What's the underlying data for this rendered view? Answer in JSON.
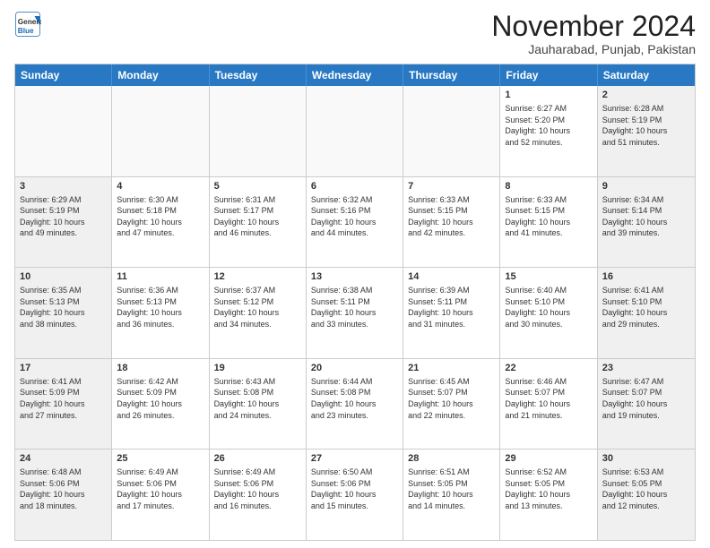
{
  "header": {
    "logo_line1": "General",
    "logo_line2": "Blue",
    "month": "November 2024",
    "location": "Jauharabad, Punjab, Pakistan"
  },
  "weekdays": [
    "Sunday",
    "Monday",
    "Tuesday",
    "Wednesday",
    "Thursday",
    "Friday",
    "Saturday"
  ],
  "rows": [
    [
      {
        "day": "",
        "info": ""
      },
      {
        "day": "",
        "info": ""
      },
      {
        "day": "",
        "info": ""
      },
      {
        "day": "",
        "info": ""
      },
      {
        "day": "",
        "info": ""
      },
      {
        "day": "1",
        "info": "Sunrise: 6:27 AM\nSunset: 5:20 PM\nDaylight: 10 hours\nand 52 minutes."
      },
      {
        "day": "2",
        "info": "Sunrise: 6:28 AM\nSunset: 5:19 PM\nDaylight: 10 hours\nand 51 minutes."
      }
    ],
    [
      {
        "day": "3",
        "info": "Sunrise: 6:29 AM\nSunset: 5:19 PM\nDaylight: 10 hours\nand 49 minutes."
      },
      {
        "day": "4",
        "info": "Sunrise: 6:30 AM\nSunset: 5:18 PM\nDaylight: 10 hours\nand 47 minutes."
      },
      {
        "day": "5",
        "info": "Sunrise: 6:31 AM\nSunset: 5:17 PM\nDaylight: 10 hours\nand 46 minutes."
      },
      {
        "day": "6",
        "info": "Sunrise: 6:32 AM\nSunset: 5:16 PM\nDaylight: 10 hours\nand 44 minutes."
      },
      {
        "day": "7",
        "info": "Sunrise: 6:33 AM\nSunset: 5:15 PM\nDaylight: 10 hours\nand 42 minutes."
      },
      {
        "day": "8",
        "info": "Sunrise: 6:33 AM\nSunset: 5:15 PM\nDaylight: 10 hours\nand 41 minutes."
      },
      {
        "day": "9",
        "info": "Sunrise: 6:34 AM\nSunset: 5:14 PM\nDaylight: 10 hours\nand 39 minutes."
      }
    ],
    [
      {
        "day": "10",
        "info": "Sunrise: 6:35 AM\nSunset: 5:13 PM\nDaylight: 10 hours\nand 38 minutes."
      },
      {
        "day": "11",
        "info": "Sunrise: 6:36 AM\nSunset: 5:13 PM\nDaylight: 10 hours\nand 36 minutes."
      },
      {
        "day": "12",
        "info": "Sunrise: 6:37 AM\nSunset: 5:12 PM\nDaylight: 10 hours\nand 34 minutes."
      },
      {
        "day": "13",
        "info": "Sunrise: 6:38 AM\nSunset: 5:11 PM\nDaylight: 10 hours\nand 33 minutes."
      },
      {
        "day": "14",
        "info": "Sunrise: 6:39 AM\nSunset: 5:11 PM\nDaylight: 10 hours\nand 31 minutes."
      },
      {
        "day": "15",
        "info": "Sunrise: 6:40 AM\nSunset: 5:10 PM\nDaylight: 10 hours\nand 30 minutes."
      },
      {
        "day": "16",
        "info": "Sunrise: 6:41 AM\nSunset: 5:10 PM\nDaylight: 10 hours\nand 29 minutes."
      }
    ],
    [
      {
        "day": "17",
        "info": "Sunrise: 6:41 AM\nSunset: 5:09 PM\nDaylight: 10 hours\nand 27 minutes."
      },
      {
        "day": "18",
        "info": "Sunrise: 6:42 AM\nSunset: 5:09 PM\nDaylight: 10 hours\nand 26 minutes."
      },
      {
        "day": "19",
        "info": "Sunrise: 6:43 AM\nSunset: 5:08 PM\nDaylight: 10 hours\nand 24 minutes."
      },
      {
        "day": "20",
        "info": "Sunrise: 6:44 AM\nSunset: 5:08 PM\nDaylight: 10 hours\nand 23 minutes."
      },
      {
        "day": "21",
        "info": "Sunrise: 6:45 AM\nSunset: 5:07 PM\nDaylight: 10 hours\nand 22 minutes."
      },
      {
        "day": "22",
        "info": "Sunrise: 6:46 AM\nSunset: 5:07 PM\nDaylight: 10 hours\nand 21 minutes."
      },
      {
        "day": "23",
        "info": "Sunrise: 6:47 AM\nSunset: 5:07 PM\nDaylight: 10 hours\nand 19 minutes."
      }
    ],
    [
      {
        "day": "24",
        "info": "Sunrise: 6:48 AM\nSunset: 5:06 PM\nDaylight: 10 hours\nand 18 minutes."
      },
      {
        "day": "25",
        "info": "Sunrise: 6:49 AM\nSunset: 5:06 PM\nDaylight: 10 hours\nand 17 minutes."
      },
      {
        "day": "26",
        "info": "Sunrise: 6:49 AM\nSunset: 5:06 PM\nDaylight: 10 hours\nand 16 minutes."
      },
      {
        "day": "27",
        "info": "Sunrise: 6:50 AM\nSunset: 5:06 PM\nDaylight: 10 hours\nand 15 minutes."
      },
      {
        "day": "28",
        "info": "Sunrise: 6:51 AM\nSunset: 5:05 PM\nDaylight: 10 hours\nand 14 minutes."
      },
      {
        "day": "29",
        "info": "Sunrise: 6:52 AM\nSunset: 5:05 PM\nDaylight: 10 hours\nand 13 minutes."
      },
      {
        "day": "30",
        "info": "Sunrise: 6:53 AM\nSunset: 5:05 PM\nDaylight: 10 hours\nand 12 minutes."
      }
    ]
  ]
}
